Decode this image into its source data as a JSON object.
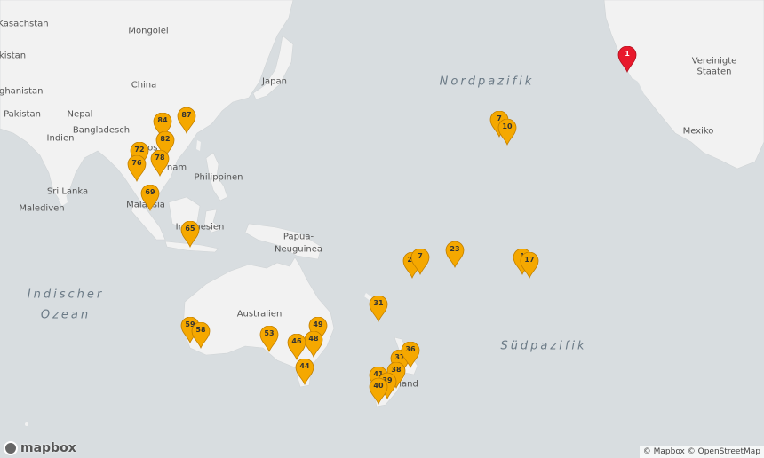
{
  "map": {
    "land_color": "#f2f2f2",
    "water_color": "#d8dde0",
    "marker_color": "#f5a800",
    "marker_highlight_color": "#e8192c"
  },
  "labels": {
    "kasachstan": "Kasachstan",
    "mongolei": "Mongolei",
    "kistan": "kistan",
    "afghanistan": "fghanistan",
    "china": "China",
    "japan": "Japan",
    "pakistan": "Pakistan",
    "nepal": "Nepal",
    "bangladesch": "Bangladesch",
    "indien": "Indien",
    "laos": "Laos",
    "nam": "nam",
    "philippinen": "Philippinen",
    "sri_lanka": "Sri Lanka",
    "malediven": "Malediven",
    "malaysia": "Malaysia",
    "indonesien": "Indonesien",
    "papua": "Papua-",
    "neuguinea": "Neuguinea",
    "australien": "Australien",
    "indischer": "Indischer",
    "ozean": "Ozean",
    "nordpazifik": "Nordpazifik",
    "suedpazifik": "Südpazifik",
    "vereinigte": "Vereinigte",
    "staaten": "Staaten",
    "mexiko": "Mexiko",
    "land": "land"
  },
  "markers": [
    "1",
    "87",
    "84",
    "82",
    "72",
    "78",
    "76",
    "69",
    "65",
    "7",
    "10",
    "23",
    "28",
    "7",
    "1",
    "17",
    "31",
    "49",
    "48",
    "46",
    "44",
    "59",
    "58",
    "53",
    "37",
    "36",
    "38",
    "41",
    "39",
    "40"
  ],
  "attribution": "© Mapbox © OpenStreetMap",
  "logo_text": "mapbox"
}
